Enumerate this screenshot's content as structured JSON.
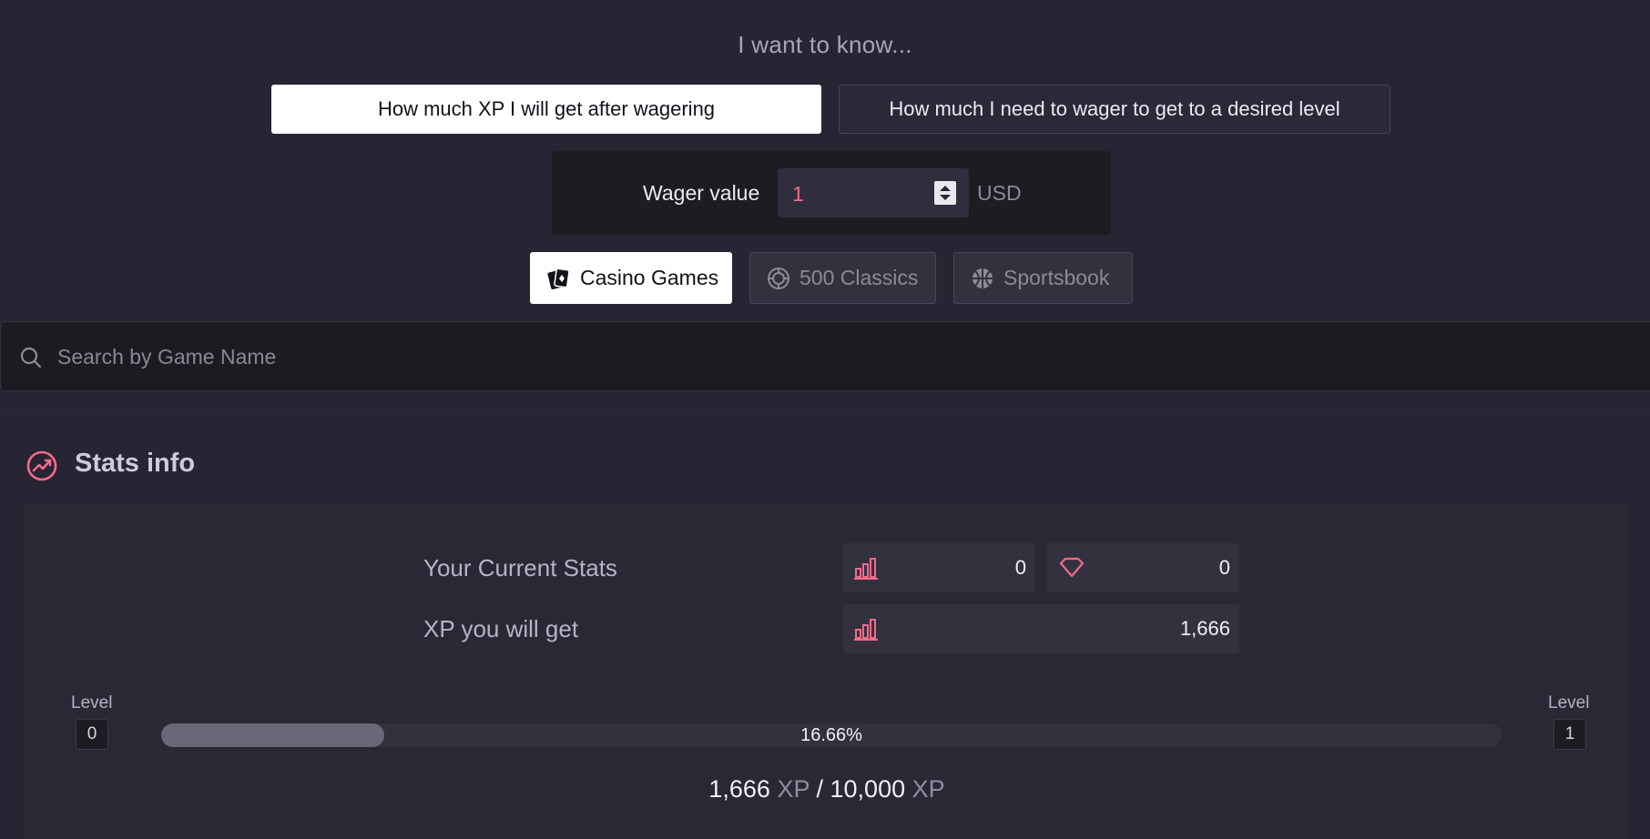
{
  "header": {
    "question": "I want to know..."
  },
  "modes": {
    "xp_after_wagering": "How much XP I will get after wagering",
    "wager_to_level": "How much I need to wager to get to a desired level",
    "active": "xp_after_wagering"
  },
  "wager": {
    "label": "Wager value",
    "value": "1",
    "currency": "USD"
  },
  "categories": {
    "items": [
      {
        "label": "Casino Games",
        "icon": "cards-icon",
        "active": true
      },
      {
        "label": "500 Classics",
        "icon": "classics-icon",
        "active": false
      },
      {
        "label": "Sportsbook",
        "icon": "basketball-icon",
        "active": false
      }
    ]
  },
  "search": {
    "placeholder": "Search by Game Name",
    "value": ""
  },
  "stats": {
    "title": "Stats info",
    "current_label": "Your Current Stats",
    "current_level_value": "0",
    "current_gems_value": "0",
    "xp_label": "XP you will get",
    "xp_value": "1,666",
    "level_from_label": "Level",
    "level_from": "0",
    "level_to_label": "Level",
    "level_to": "1",
    "progress_percent": 16.66,
    "progress_text": "16.66%",
    "xp_current": "1,666",
    "xp_unit": "XP",
    "xp_separator": "/",
    "xp_target": "10,000"
  },
  "colors": {
    "background": "#272433",
    "accent": "#f06b8a",
    "panel": "#2b2836",
    "active_button": "#ffffff"
  }
}
